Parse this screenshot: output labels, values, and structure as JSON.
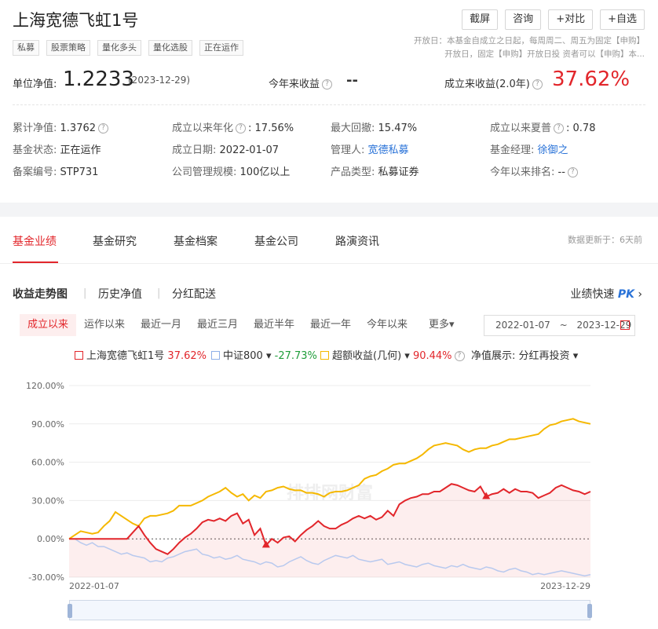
{
  "header": {
    "title": "上海宽德飞虹1号",
    "tags": [
      "私募",
      "股票策略",
      "量化多头",
      "量化选股",
      "正在运作"
    ],
    "buttons": [
      "截屏",
      "咨询",
      "+对比",
      "+自选"
    ],
    "notice": "开放日：本基金自成立之日起，每周周二、周五为固定【申购】开放日，固定【申购】开放日投 资者可以【申购】本..."
  },
  "nav": {
    "label": "单位净值:",
    "value": "1.2233",
    "date": "(2023-12-29)",
    "ytd_label": "今年来收益",
    "ytd_value": "--",
    "since_label": "成立来收益(2.0年)",
    "since_value": "37.62%"
  },
  "info": [
    {
      "k": "累计净值:",
      "v": "1.3762",
      "help": true
    },
    {
      "k": "成立以来年化",
      "v": "17.56%",
      "help": true
    },
    {
      "k": "最大回撤:",
      "v": "15.47%"
    },
    {
      "k": "成立以来夏普",
      "v": "0.78",
      "help": true
    },
    {
      "k": "基金状态:",
      "v": "正在运作"
    },
    {
      "k": "成立日期:",
      "v": "2022-01-07"
    },
    {
      "k": "管理人:",
      "v": "宽德私募",
      "link": true
    },
    {
      "k": "基金经理:",
      "v": "徐御之",
      "link": true
    },
    {
      "k": "备案编号:",
      "v": "STP731"
    },
    {
      "k": "公司管理规模:",
      "v": "100亿以上"
    },
    {
      "k": "产品类型:",
      "v": "私募证券"
    },
    {
      "k": "今年以来排名:",
      "v": "--",
      "help": true
    }
  ],
  "tabs": [
    "基金业绩",
    "基金研究",
    "基金档案",
    "基金公司",
    "路演资讯"
  ],
  "updated": "数据更新于：6天前",
  "subtabs": [
    "收益走势图",
    "历史净值",
    "分红配送"
  ],
  "quick": {
    "label": "业绩快速",
    "pk": "PK"
  },
  "ranges": [
    "成立以来",
    "运作以来",
    "最近一月",
    "最近三月",
    "最近半年",
    "最近一年",
    "今年以来",
    "更多"
  ],
  "date_from": "2022-01-07",
  "date_tilde": "~",
  "date_to": "2023-12-29",
  "legend": {
    "fund_name": "上海宽德飞虹1号",
    "fund_value": "37.62%",
    "index_name": "中证800",
    "index_value": "-27.73%",
    "excess_name": "超额收益(几何)",
    "excess_value": "90.44%",
    "nav_display_label": "净值展示:",
    "nav_display_value": "分红再投资"
  },
  "colors": {
    "fund": "#e2262b",
    "index": "#b8c9ee",
    "excess": "#f5b800"
  },
  "chart_data": {
    "type": "line",
    "y_ticks": [
      "120.00%",
      "90.00%",
      "60.00%",
      "30.00%",
      "0.00%",
      "-30.00%"
    ],
    "ylim": [
      -30,
      120
    ],
    "x_start": "2022-01-07",
    "x_end": "2023-12-29",
    "watermark": "排排网财富",
    "series": [
      {
        "name": "上海宽德飞虹1号",
        "values": [
          0,
          0,
          0,
          0,
          0,
          0,
          0,
          0,
          0,
          0,
          0,
          5,
          10,
          3,
          -3,
          -8,
          -10,
          -12,
          -8,
          -3,
          1,
          4,
          8,
          13,
          15,
          14,
          16,
          14,
          18,
          20,
          12,
          15,
          3,
          8,
          -5,
          0,
          -3,
          1,
          2,
          -2,
          3,
          7,
          10,
          14,
          10,
          8,
          8,
          11,
          13,
          16,
          18,
          16,
          18,
          15,
          17,
          22,
          18,
          27,
          30,
          32,
          33,
          35,
          35,
          37,
          37,
          40,
          43,
          42,
          40,
          38,
          37,
          41,
          33,
          35,
          36,
          39,
          36,
          39,
          37,
          37,
          36,
          32,
          34,
          36,
          40,
          42,
          40,
          38,
          37,
          35,
          37
        ]
      },
      {
        "name": "中证800",
        "values": [
          0,
          0,
          -3,
          -5,
          -3,
          -6,
          -6,
          -8,
          -10,
          -12,
          -11,
          -13,
          -14,
          -15,
          -18,
          -17,
          -18,
          -15,
          -14,
          -12,
          -10,
          -9,
          -8,
          -12,
          -13,
          -15,
          -14,
          -16,
          -15,
          -13,
          -16,
          -17,
          -18,
          -20,
          -18,
          -19,
          -22,
          -21,
          -18,
          -16,
          -14,
          -17,
          -19,
          -20,
          -17,
          -15,
          -13,
          -14,
          -15,
          -13,
          -16,
          -17,
          -18,
          -17,
          -16,
          -20,
          -19,
          -18,
          -20,
          -21,
          -22,
          -20,
          -19,
          -21,
          -22,
          -23,
          -21,
          -22,
          -20,
          -22,
          -23,
          -24,
          -22,
          -23,
          -25,
          -26,
          -24,
          -23,
          -25,
          -26,
          -28,
          -27,
          -28,
          -27,
          -26,
          -25,
          -26,
          -27,
          -28,
          -29,
          -28
        ]
      },
      {
        "name": "超额收益(几何)",
        "values": [
          0,
          3,
          6,
          5,
          4,
          5,
          10,
          14,
          21,
          18,
          15,
          12,
          10,
          16,
          18,
          18,
          19,
          20,
          22,
          26,
          26,
          26,
          28,
          30,
          33,
          35,
          37,
          40,
          36,
          33,
          35,
          30,
          34,
          32,
          37,
          38,
          40,
          41,
          39,
          38,
          38,
          36,
          36,
          35,
          33,
          36,
          37,
          37,
          38,
          40,
          42,
          47,
          49,
          50,
          53,
          55,
          58,
          59,
          59,
          61,
          63,
          66,
          70,
          73,
          74,
          75,
          74,
          73,
          70,
          68,
          70,
          71,
          71,
          73,
          74,
          76,
          78,
          78,
          79,
          80,
          81,
          82,
          86,
          89,
          90,
          92,
          93,
          94,
          92,
          91,
          90
        ]
      }
    ],
    "markers": [
      {
        "series": 0,
        "label": "▲",
        "index": 34
      },
      {
        "series": 0,
        "label": "▲",
        "index": 72
      }
    ]
  }
}
